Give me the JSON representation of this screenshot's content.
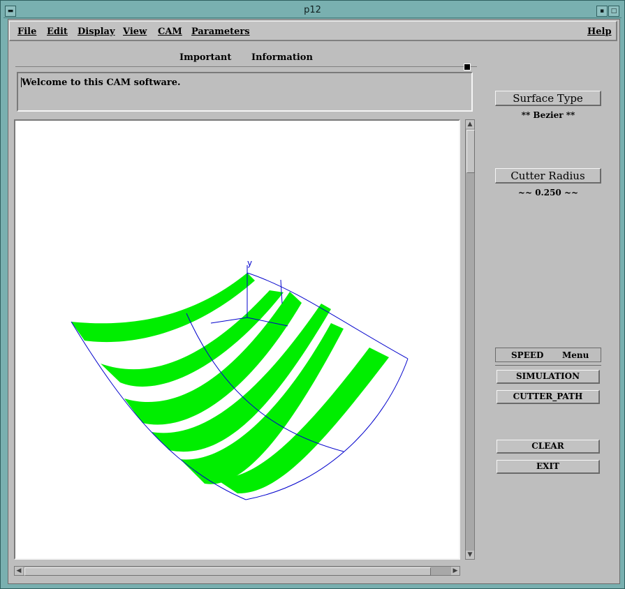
{
  "window": {
    "title": "p12"
  },
  "menubar": {
    "file": "File",
    "edit": "Edit",
    "display": "Display",
    "view": "View",
    "cam": "CAM",
    "parameters": "Parameters",
    "help": "Help"
  },
  "info": {
    "important": "Important",
    "information": "Information",
    "message": "Welcome to this CAM  software."
  },
  "side": {
    "surface_type_label": "Surface Type",
    "surface_type_value": "**  Bezier **",
    "cutter_radius_label": "Cutter Radius",
    "cutter_radius_value": "~~  0.250  ~~",
    "speed": "SPEED",
    "menu": "Menu",
    "simulation": "SIMULATION",
    "cutter_path": "CUTTER_PATH",
    "clear": "CLEAR",
    "exit": "EXIT"
  },
  "viewport": {
    "axis_label": "y",
    "stripe_color": "#00ee00",
    "line_color": "#0000cc"
  }
}
